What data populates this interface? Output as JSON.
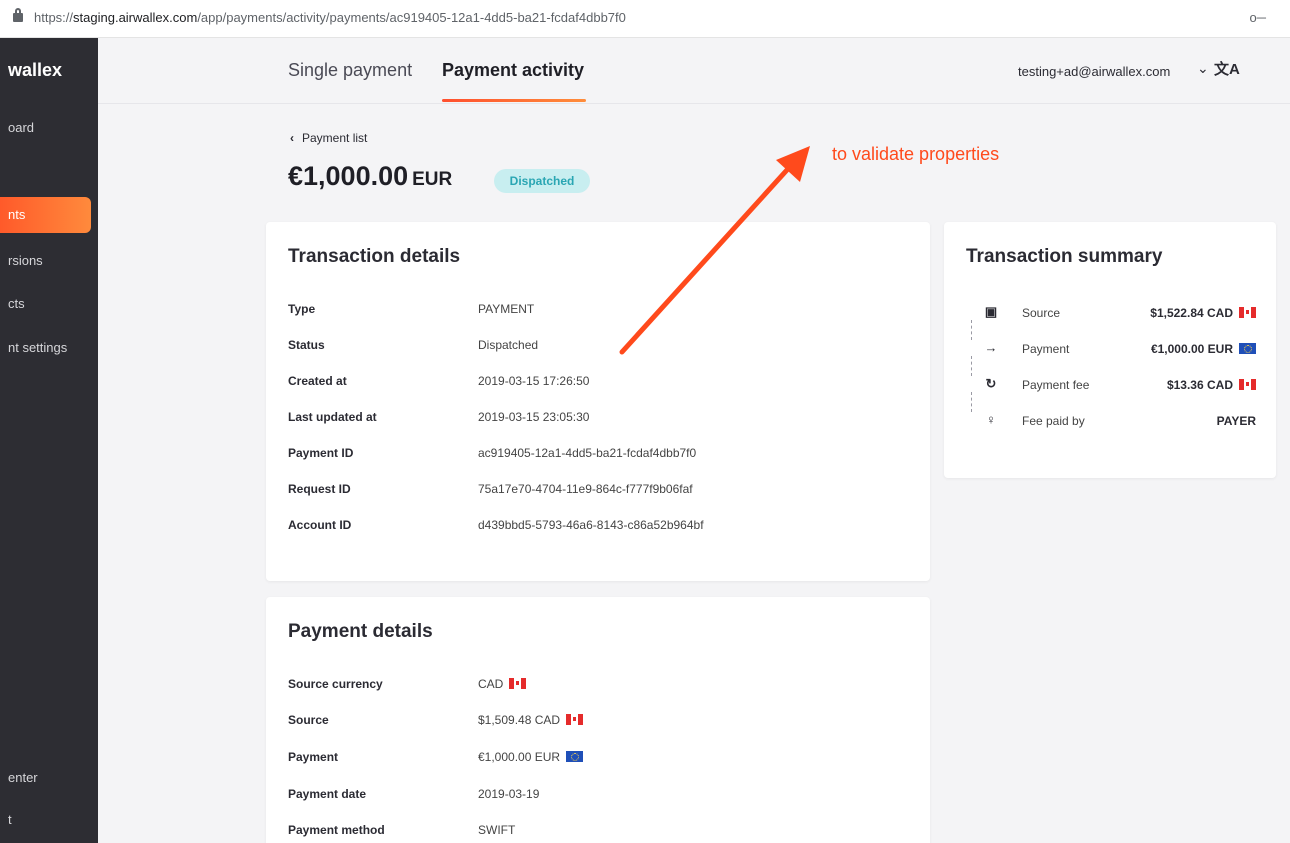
{
  "browser": {
    "url_scheme": "https://",
    "url_host": "staging.airwallex.com",
    "url_path": "/app/payments/activity/payments/ac919405-12a1-4dd5-ba21-fcdaf4dbb7f0",
    "key_icon": "key-icon"
  },
  "sidebar": {
    "brand": "wallex",
    "items": [
      {
        "label": "oard"
      },
      {
        "label": "nts"
      },
      {
        "label": "rsions"
      },
      {
        "label": "cts"
      },
      {
        "label": "nt settings"
      },
      {
        "label": "enter"
      },
      {
        "label": "t"
      }
    ]
  },
  "header": {
    "tabs": [
      {
        "label": "Single payment"
      },
      {
        "label": "Payment activity"
      }
    ],
    "user_email": "testing+ad@airwallex.com",
    "chevron": "⌄",
    "lang_icon": "文A"
  },
  "page": {
    "back_label": "Payment list",
    "amount": "€1,000.00",
    "currency": "EUR",
    "status": "Dispatched"
  },
  "annotation": {
    "text": "to validate properties",
    "color": "#ff4a1c"
  },
  "transaction_details": {
    "title": "Transaction details",
    "rows": [
      {
        "label": "Type",
        "value": "PAYMENT"
      },
      {
        "label": "Status",
        "value": "Dispatched"
      },
      {
        "label": "Created at",
        "value": "2019-03-15 17:26:50"
      },
      {
        "label": "Last updated at",
        "value": "2019-03-15 23:05:30"
      },
      {
        "label": "Payment ID",
        "value": "ac919405-12a1-4dd5-ba21-fcdaf4dbb7f0"
      },
      {
        "label": "Request ID",
        "value": "75a17e70-4704-11e9-864c-f777f9b06faf"
      },
      {
        "label": "Account ID",
        "value": "d439bbd5-5793-46a6-8143-c86a52b964bf"
      }
    ]
  },
  "payment_details": {
    "title": "Payment details",
    "rows": [
      {
        "label": "Source currency",
        "value": "CAD",
        "flag": "ca"
      },
      {
        "label": "Source",
        "value": "$1,509.48 CAD",
        "flag": "ca"
      },
      {
        "label": "Payment",
        "value": "€1,000.00 EUR",
        "flag": "eu"
      },
      {
        "label": "Payment date",
        "value": "2019-03-19"
      },
      {
        "label": "Payment method",
        "value": "SWIFT"
      }
    ]
  },
  "transaction_summary": {
    "title": "Transaction summary",
    "rows": [
      {
        "icon": "cash-icon",
        "label": "Source",
        "value": "$1,522.84 CAD",
        "flag": "ca"
      },
      {
        "icon": "arrow-right-icon",
        "label": "Payment",
        "value": "€1,000.00 EUR",
        "flag": "eu"
      },
      {
        "icon": "refresh-icon",
        "label": "Payment fee",
        "value": "$13.36 CAD",
        "flag": "ca"
      },
      {
        "icon": "user-icon",
        "label": "Fee paid by",
        "value": "PAYER"
      }
    ]
  },
  "colors": {
    "accent": "#ff5a2a",
    "badge_bg": "#c8eef0",
    "badge_text": "#2aa6b3",
    "sidebar_bg": "#2d2d33"
  }
}
